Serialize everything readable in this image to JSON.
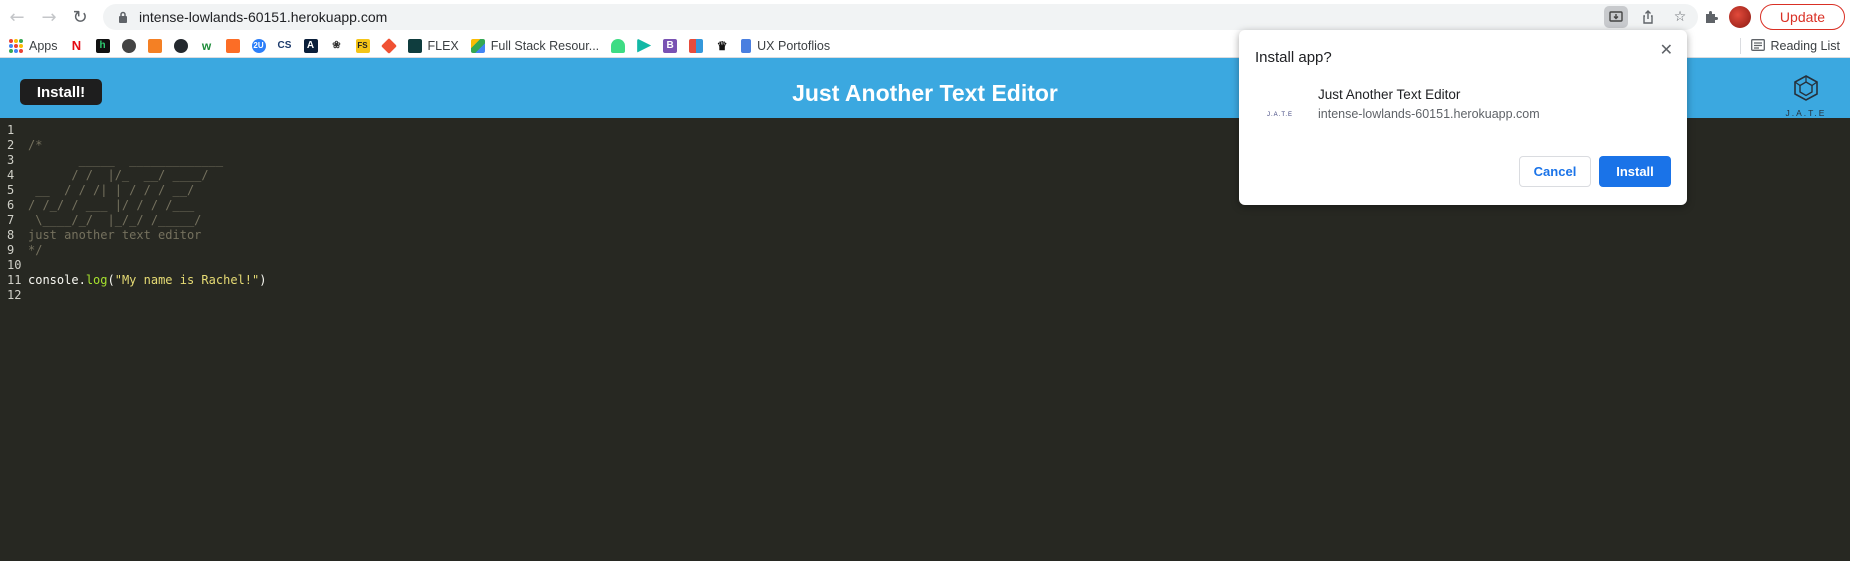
{
  "browser": {
    "url": "intense-lowlands-60151.herokuapp.com",
    "update_label": "Update"
  },
  "bookmarks": {
    "apps_label": "Apps",
    "flex_label": "FLEX",
    "fullstack_label": "Full Stack Resour...",
    "ux_label": "UX Portoflios",
    "reading_list_label": "Reading List"
  },
  "app": {
    "install_label": "Install!",
    "title": "Just Another Text Editor",
    "logo_caption": "J.A.T.E"
  },
  "editor": {
    "line_numbers": [
      "1",
      "2",
      "3",
      "4",
      "5",
      "6",
      "7",
      "8",
      "9",
      "10",
      "11",
      "12"
    ],
    "lines": [
      "",
      "/*",
      "       _____  _____________",
      "      / /  |/_  __/ ____/",
      " __  / / /| | / / / __/",
      "/ /_/ / ___ |/ / / /___",
      " \\____/_/  |_/_/ /_____/",
      "just another text editor",
      "*/",
      "",
      "",
      ""
    ],
    "code_object": "console",
    "code_dot": ".",
    "code_fn": "log",
    "code_open": "(",
    "code_string": "\"My name is Rachel!\"",
    "code_close": ")"
  },
  "dialog": {
    "title": "Install app?",
    "app_name": "Just Another Text Editor",
    "app_origin": "intense-lowlands-60151.herokuapp.com",
    "icon_text": "J.A.T.E",
    "cancel_label": "Cancel",
    "install_label": "Install"
  },
  "colors": {
    "header_blue": "#3ba8e0",
    "editor_bg": "#272822",
    "primary_button": "#1a73e8"
  }
}
